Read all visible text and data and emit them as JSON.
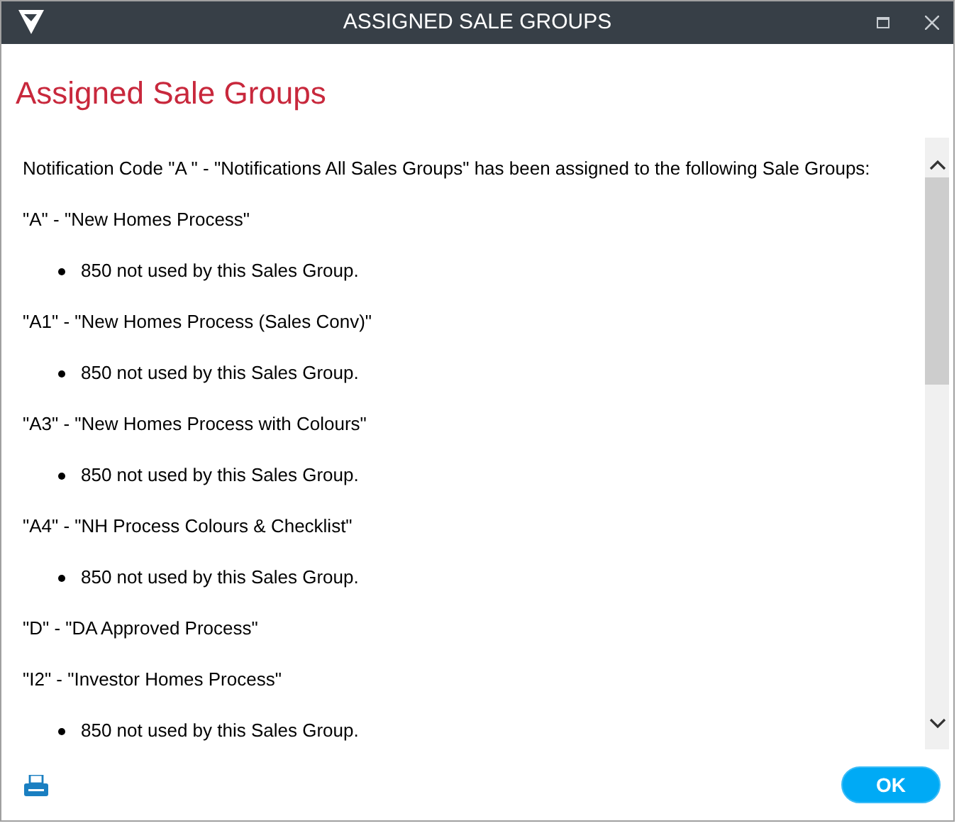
{
  "window": {
    "title": "ASSIGNED SALE GROUPS"
  },
  "heading": "Assigned Sale Groups",
  "intro": "Notification Code \"A \" - \"Notifications All Sales Groups\" has been assigned to the following Sale Groups:",
  "groups": [
    {
      "name": "\"A\" - \"New Homes Process\"",
      "notes": [
        "850 not used by this Sales Group."
      ]
    },
    {
      "name": "\"A1\" - \"New Homes Process (Sales Conv)\"",
      "notes": [
        "850 not used by this Sales Group."
      ]
    },
    {
      "name": "\"A3\" - \"New Homes Process with Colours\"",
      "notes": [
        "850 not used by this Sales Group."
      ]
    },
    {
      "name": "\"A4\" - \"NH Process Colours & Checklist\"",
      "notes": [
        "850 not used by this Sales Group."
      ]
    },
    {
      "name": "\"D\" - \"DA Approved Process\""
    },
    {
      "name": "\"I2\" - \"Investor Homes Process\"",
      "notes": [
        "850 not used by this Sales Group."
      ]
    }
  ],
  "buttons": {
    "ok": "OK"
  }
}
